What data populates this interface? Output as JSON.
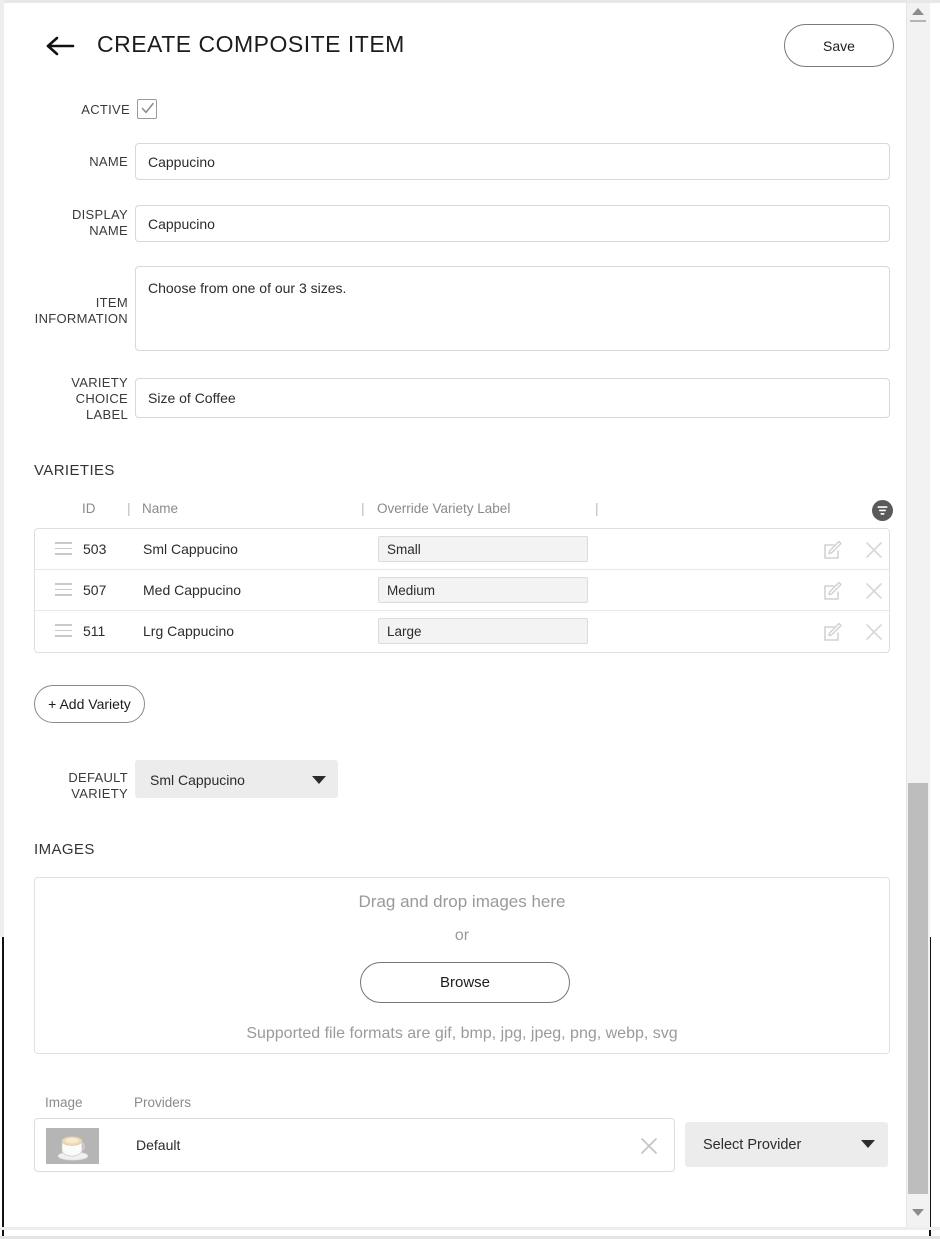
{
  "header": {
    "back_icon": "arrow-left-icon",
    "title": "CREATE COMPOSITE ITEM",
    "save_label": "Save"
  },
  "form": {
    "active": {
      "label": "ACTIVE",
      "checked": true
    },
    "name": {
      "label": "NAME",
      "value": "Cappucino",
      "placeholder": ""
    },
    "display_name": {
      "label_line1": "DISPLAY",
      "label_line2": "NAME",
      "value": "Cappucino",
      "placeholder": ""
    },
    "item_information": {
      "label_line1": "ITEM",
      "label_line2": "INFORMATION",
      "value": "Choose from one of our 3 sizes.",
      "placeholder": ""
    },
    "variety_choice_label": {
      "label_line1": "VARIETY",
      "label_line2": "CHOICE",
      "label_line3": "LABEL",
      "value": "Size of Coffee",
      "placeholder": ""
    }
  },
  "varieties": {
    "section_title": "VARIETIES",
    "columns": [
      "ID",
      "Name",
      "Override Variety Label",
      ""
    ],
    "separator": "|",
    "filter_icon": "filter-icon",
    "rows": [
      {
        "id": "503",
        "name": "Sml Cappucino",
        "override": "Small",
        "drag_icon": "drag-handle-icon",
        "edit_icon": "edit-icon",
        "delete_icon": "close-icon"
      },
      {
        "id": "507",
        "name": "Med Cappucino",
        "override": "Medium",
        "drag_icon": "drag-handle-icon",
        "edit_icon": "edit-icon",
        "delete_icon": "close-icon"
      },
      {
        "id": "511",
        "name": "Lrg Cappucino",
        "override": "Large",
        "drag_icon": "drag-handle-icon",
        "edit_icon": "edit-icon",
        "delete_icon": "close-icon"
      }
    ],
    "add_button": "+ Add Variety"
  },
  "default_variety": {
    "label_line1": "DEFAULT",
    "label_line2": "VARIETY",
    "selected": "Sml Cappucino",
    "caret_icon": "chevron-down-icon"
  },
  "images": {
    "section_title": "IMAGES",
    "dropzone_primary": "Drag and drop images here",
    "dropzone_or": "or",
    "browse_label": "Browse",
    "supported_formats": "Supported file formats are gif, bmp, jpg, jpeg, png, webp, svg"
  },
  "providers": {
    "header_image": "Image",
    "header_providers": "Providers",
    "row": {
      "thumbnail_icon": "cappuccino-cup-thumbnail",
      "name": "Default",
      "remove_icon": "close-icon"
    },
    "select_placeholder": "Select Provider",
    "caret_icon": "chevron-down-icon"
  },
  "scrollbar": {
    "up_icon": "scroll-up-arrow-icon",
    "down_icon": "scroll-down-arrow-icon"
  }
}
